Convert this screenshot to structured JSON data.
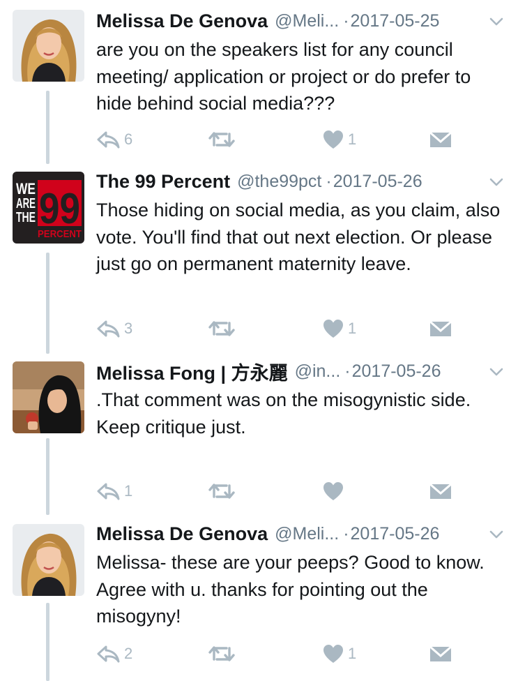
{
  "tweets": [
    {
      "name": "Melissa De Genova",
      "handle": "@Meli...",
      "dot": "·",
      "date": "2017-05-25",
      "lines": [
        "are you on the speakers list for any council meeting/ application or project or do prefer to hide behind social media???"
      ],
      "reply_count": "6",
      "retweet_count": "",
      "like_count": "1"
    },
    {
      "name": "The 99 Percent",
      "handle": "@the99pct",
      "dot": "·",
      "date": "2017-05-26",
      "lines": [
        "Those hiding on social media, as you claim, also vote. You'll find that out next election. Or please just go on permanent maternity leave."
      ],
      "reply_count": "3",
      "retweet_count": "",
      "like_count": "1",
      "avatar_text": {
        "we": "WE",
        "are": "ARE",
        "the": "THE",
        "num": "99",
        "percent": "PERCENT"
      }
    },
    {
      "name": "Melissa Fong | 方永麗",
      "handle": "@in...",
      "dot": "·",
      "date": "2017-05-26",
      "lines": [
        ".That comment was on the misogynistic side.",
        "Keep critique just."
      ],
      "reply_count": "1",
      "retweet_count": "",
      "like_count": ""
    },
    {
      "name": "Melissa De Genova",
      "handle": "@Meli...",
      "dot": "·",
      "date": "2017-05-26",
      "lines": [
        "Melissa- these are your peeps? Good to know. Agree with u. thanks for pointing out the misogyny!"
      ],
      "reply_count": "2",
      "retweet_count": "",
      "like_count": "1"
    }
  ],
  "icons": {
    "reply": "reply-icon",
    "retweet": "retweet-icon",
    "like": "heart-icon",
    "dm": "envelope-icon",
    "menu": "chevron-down-icon"
  },
  "colors": {
    "icon_gray": "#aab8c2",
    "meta_gray": "#657786",
    "thread_line": "#ccd6dd",
    "logo_red": "#d0021b"
  }
}
